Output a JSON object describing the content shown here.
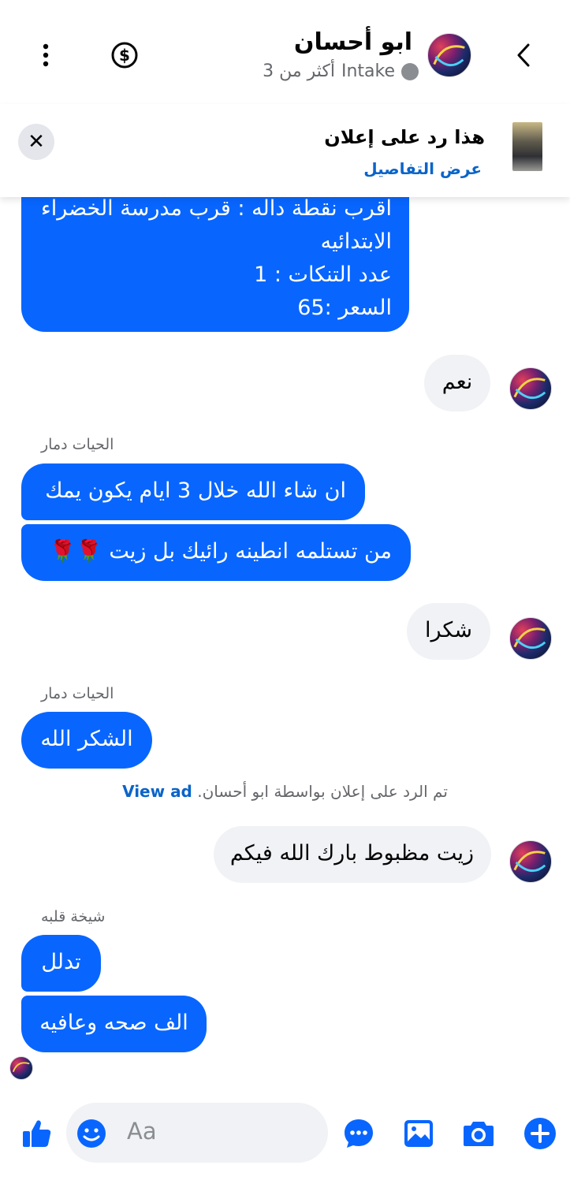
{
  "header": {
    "contact_name": "ابو أحسان",
    "status_label": "Intake",
    "status_more": "أكثر من 3",
    "back_icon": "chevron-left-icon",
    "money_icon": "dollar-icon",
    "menu_icon": "more-vertical-icon"
  },
  "ad_banner": {
    "title": "هذا رد على إعلان",
    "link_text": "عرض التفاصيل",
    "close_glyph": "✕"
  },
  "messages": {
    "m0": {
      "lines": [
        "اقرب نقطة داله : قرب مدرسة الخضراء",
        "الابتدائيه",
        "عدد التنكات : 1",
        "السعر :65"
      ]
    },
    "m1": {
      "text": "نعم"
    },
    "sender_1": "الحيات دمار",
    "m2": {
      "text": "ان شاء الله خلال 3 ايام يكون يمك"
    },
    "m3": {
      "text": "من تستلمه انطينه رائيك بل زيت 🌹🌹"
    },
    "m4": {
      "text": "شكرا"
    },
    "sender_2": "الحيات دمار",
    "m5": {
      "text": "الشكر الله"
    },
    "notice": {
      "text": "تم الرد على إعلان بواسطة ابو أحسان.",
      "link": "View ad"
    },
    "m6": {
      "text": "زيت مظبوط بارك الله فيكم"
    },
    "sender_3": "شيخة قلبه",
    "m7": {
      "text": "تدلل"
    },
    "m8": {
      "text": "الف صحه وعافيه"
    }
  },
  "composer": {
    "placeholder": "Aa",
    "icons": [
      "plus-icon",
      "camera-icon",
      "image-icon",
      "chat-more-icon",
      "emoji-icon",
      "like-icon"
    ]
  },
  "colors": {
    "accent": "#0866ff",
    "incoming_bubble": "#f0f2f5",
    "link": "#0a64c9",
    "secondary_text": "#65676b"
  }
}
